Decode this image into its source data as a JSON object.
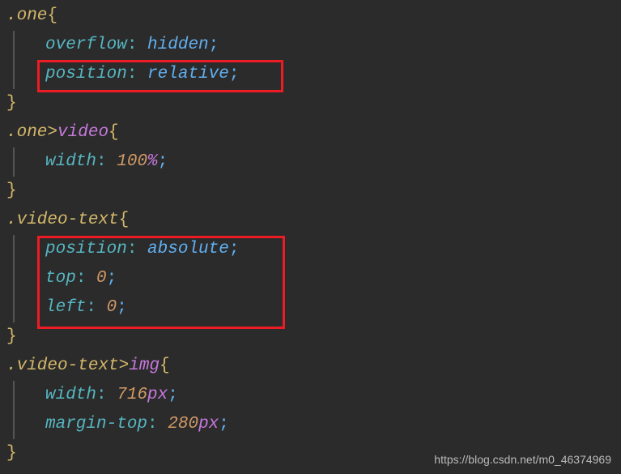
{
  "css": {
    "rules": [
      {
        "selector_class": ".one",
        "selector_tag": "",
        "decls": [
          {
            "prop": "overflow",
            "val": "hidden",
            "type": "keyword"
          },
          {
            "prop": "position",
            "val": "relative",
            "type": "keyword"
          }
        ]
      },
      {
        "selector_class": ".one",
        "combinator": ">",
        "selector_tag": "video",
        "decls": [
          {
            "prop": "width",
            "num": "100",
            "unit": "%",
            "type": "number"
          }
        ]
      },
      {
        "selector_class": ".video-text",
        "selector_tag": "",
        "decls": [
          {
            "prop": "position",
            "val": "absolute",
            "type": "keyword"
          },
          {
            "prop": "top",
            "num": "0",
            "unit": "",
            "type": "number"
          },
          {
            "prop": "left",
            "num": "0",
            "unit": "",
            "type": "number"
          }
        ]
      },
      {
        "selector_class": ".video-text",
        "combinator": ">",
        "selector_tag": "img",
        "decls": [
          {
            "prop": "width",
            "num": "716",
            "unit": "px",
            "type": "number"
          },
          {
            "prop": "margin-top",
            "num": "280",
            "unit": "px",
            "type": "number"
          }
        ]
      }
    ]
  },
  "watermark": "https://blog.csdn.net/m0_46374969"
}
